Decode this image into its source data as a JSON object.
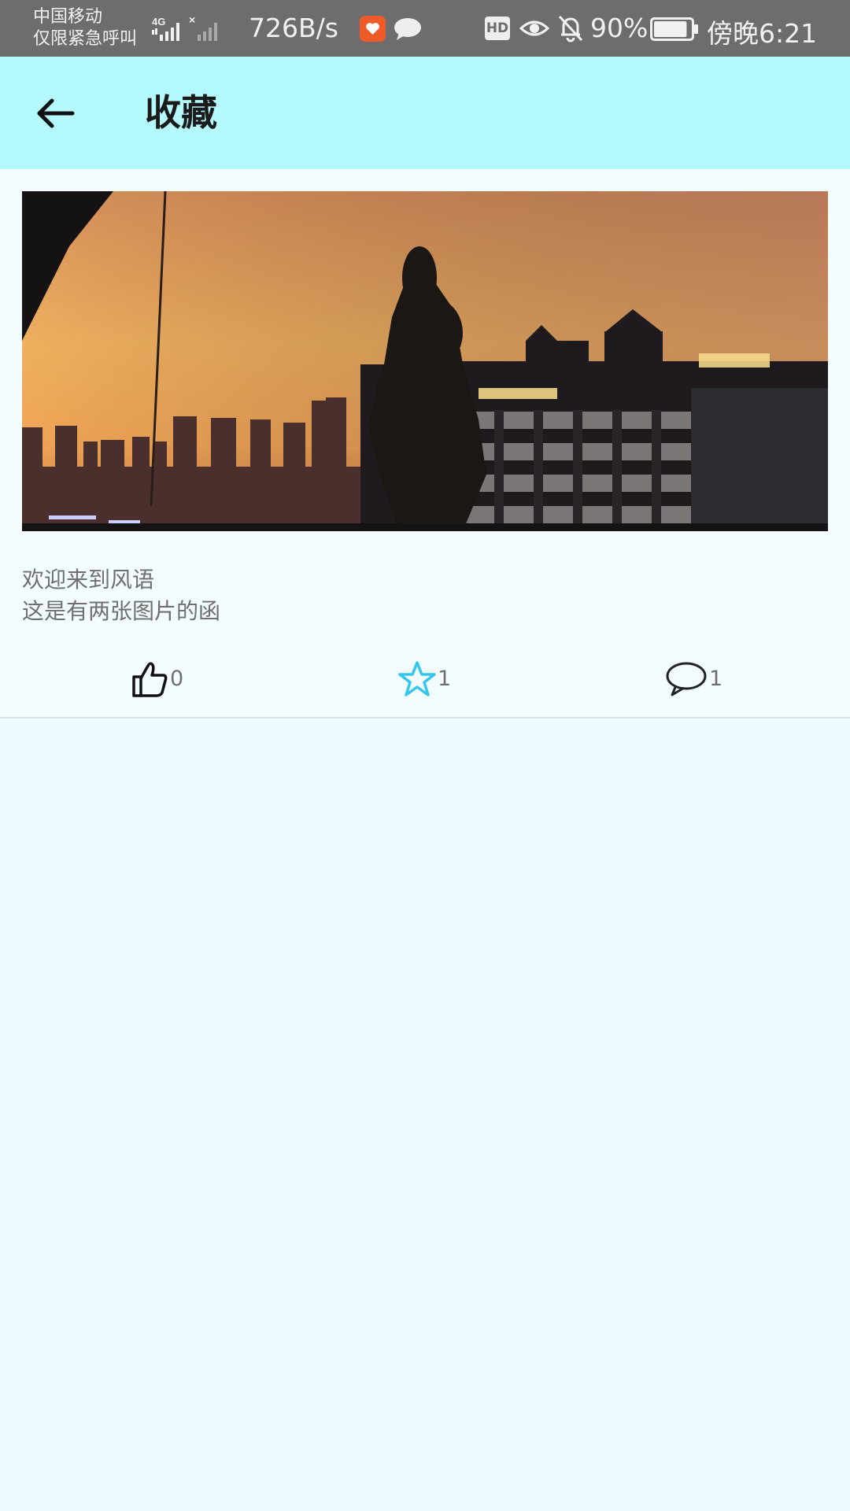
{
  "status_bar": {
    "carrier_line1": "中国移动",
    "carrier_line2": "仅限紧急呼叫",
    "network_type": "4G",
    "net_speed": "726B/s",
    "hd_label": "HD",
    "battery_percent": "90%",
    "battery_level": 0.9,
    "time": "傍晚6:21"
  },
  "app_bar": {
    "back_icon": "arrow-left-icon",
    "title": "收藏"
  },
  "post": {
    "image_description_icon": "photo",
    "line1": "欢迎来到风语",
    "line2": "这是有两张图片的函",
    "like_count": "0",
    "favorite_count": "1",
    "comment_count": "1"
  },
  "colors": {
    "status_bar_bg": "#6d6d6d",
    "app_bar_bg": "#b3f9fd",
    "page_bg": "#eefcff",
    "favorite_accent": "#35c6ee"
  }
}
